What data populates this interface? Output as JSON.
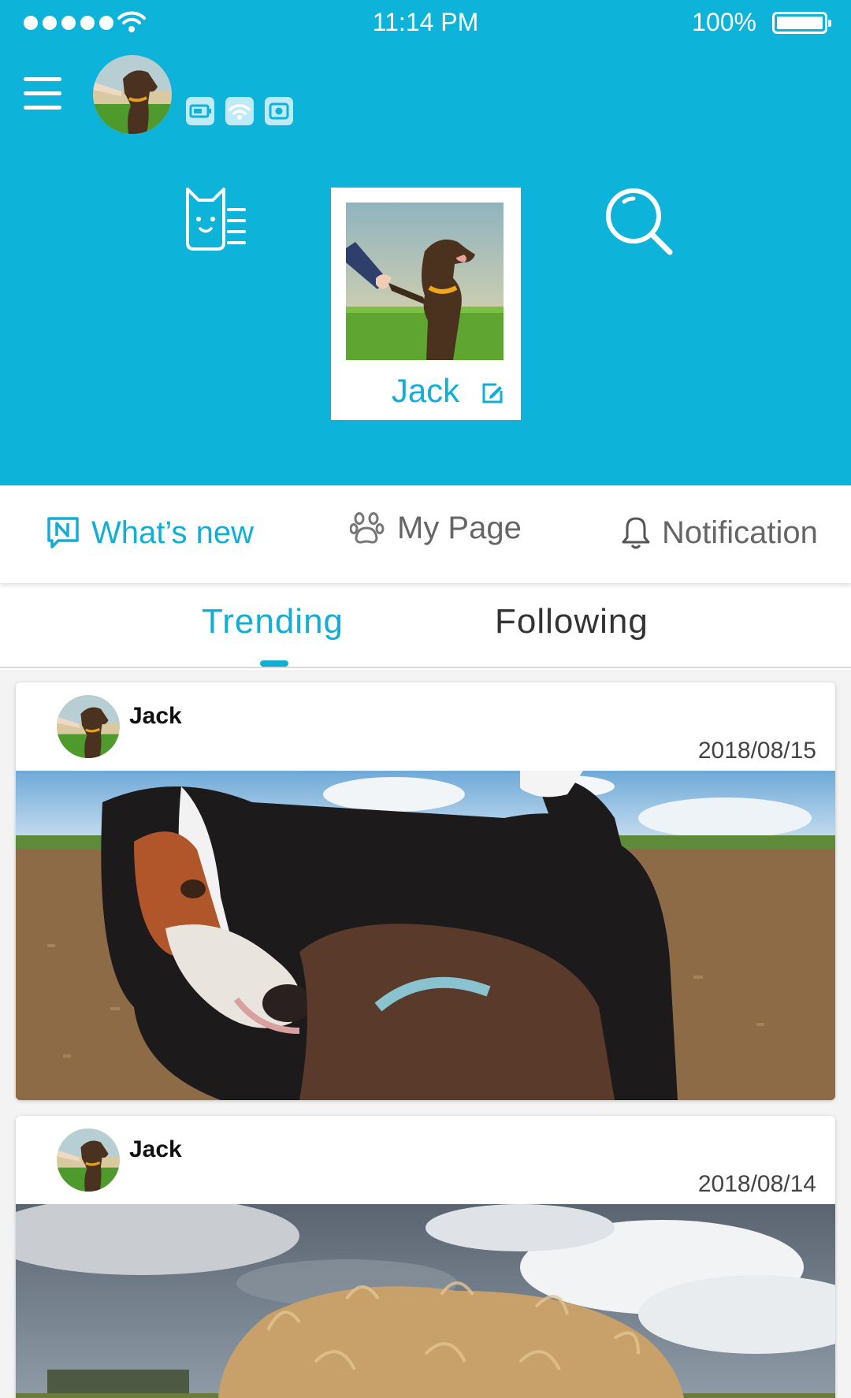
{
  "status_bar": {
    "time": "11:14 PM",
    "battery": "100%"
  },
  "profile": {
    "name": "Jack"
  },
  "main_nav": {
    "items": [
      {
        "label": "What’s new",
        "icon": "news-icon",
        "active": true
      },
      {
        "label": "My Page",
        "icon": "paw-icon",
        "active": false
      },
      {
        "label": "Notification",
        "icon": "bell-icon",
        "active": false
      }
    ]
  },
  "sub_tabs": {
    "items": [
      {
        "label": "Trending",
        "active": true
      },
      {
        "label": "Following",
        "active": false
      }
    ]
  },
  "feed": {
    "posts": [
      {
        "author": "Jack",
        "date": "2018/08/15"
      },
      {
        "author": "Jack",
        "date": "2018/08/14"
      }
    ]
  },
  "colors": {
    "accent": "#0db3d9",
    "active_text": "#12aed6"
  }
}
